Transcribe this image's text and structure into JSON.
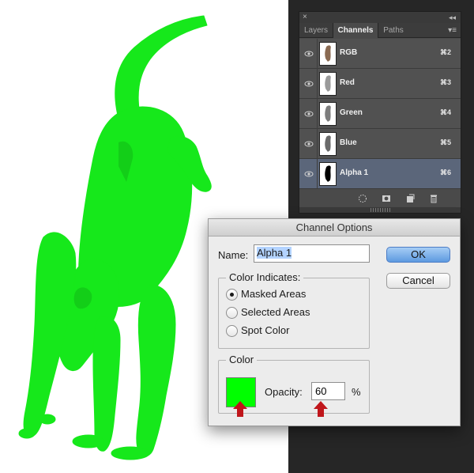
{
  "panel": {
    "close_glyph": "×",
    "collapse_glyph": "◂◂",
    "menu_glyph": "▾≡",
    "tabs": [
      {
        "label": "Layers",
        "active": false
      },
      {
        "label": "Channels",
        "active": true
      },
      {
        "label": "Paths",
        "active": false
      }
    ],
    "channels": [
      {
        "name": "RGB",
        "shortcut": "⌘2",
        "selected": false
      },
      {
        "name": "Red",
        "shortcut": "⌘3",
        "selected": false
      },
      {
        "name": "Green",
        "shortcut": "⌘4",
        "selected": false
      },
      {
        "name": "Blue",
        "shortcut": "⌘5",
        "selected": false
      },
      {
        "name": "Alpha 1",
        "shortcut": "⌘6",
        "selected": true
      }
    ],
    "footer_icons": [
      "load-selection-icon",
      "save-selection-icon",
      "new-channel-icon",
      "trash-icon"
    ]
  },
  "dialog": {
    "title": "Channel Options",
    "name_label": "Name:",
    "name_value": "Alpha 1",
    "ok_label": "OK",
    "cancel_label": "Cancel",
    "color_indicates": {
      "title": "Color Indicates:",
      "options": [
        {
          "label": "Masked Areas",
          "selected": true
        },
        {
          "label": "Selected Areas",
          "selected": false
        },
        {
          "label": "Spot Color",
          "selected": false
        }
      ]
    },
    "color_group": {
      "title": "Color",
      "swatch_color": "#00ff00",
      "opacity_label": "Opacity:",
      "opacity_value": "60",
      "percent_sign": "%"
    }
  },
  "colors": {
    "overlay_green": "#16e81b",
    "annotation_arrow": "#c0161b",
    "panel_selected": "#5b667a"
  }
}
